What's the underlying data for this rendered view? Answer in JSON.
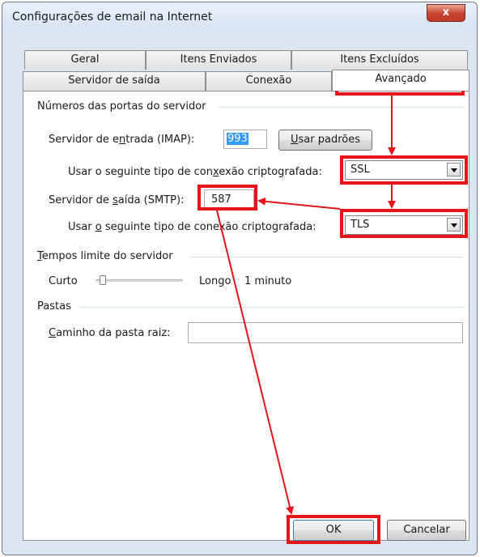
{
  "window": {
    "title": "Configurações de email na Internet",
    "close_label": "x"
  },
  "tabs": {
    "row1": [
      "Geral",
      "Itens Enviados",
      "Itens Excluídos"
    ],
    "row2": [
      "Servidor de saída",
      "Conexão",
      "Avançado"
    ],
    "active": "Avançado"
  },
  "ports": {
    "section_title": "Números das portas do servidor",
    "incoming": {
      "label_pre": "Servidor de e",
      "label_u": "n",
      "label_post": "trada (IMAP):",
      "value": "993"
    },
    "use_defaults": {
      "label_u": "U",
      "label_post": "sar padrões"
    },
    "incoming_encryption": {
      "label_pre": "Usar o seguinte tipo de con",
      "label_u": "x",
      "label_post": "exão criptografada:",
      "value": "SSL"
    },
    "outgoing": {
      "label_pre": "Servidor de ",
      "label_u": "s",
      "label_post": "aída (SMTP):",
      "value": "587"
    },
    "outgoing_encryption": {
      "label_pre": "Usar ",
      "label_u": "o",
      "label_post": " seguinte tipo de conexão criptografada:",
      "value": "TLS"
    }
  },
  "timeouts": {
    "section_title_u": "T",
    "section_title_post": "empos limite do servidor",
    "short_label": "Curto",
    "long_label": "Longo",
    "value_text": "1 minuto",
    "slider_level": 0.05
  },
  "folders": {
    "section_title": "Pastas",
    "root_path_label_u": "C",
    "root_path_label_post": "aminho da pasta raiz:",
    "root_path_value": ""
  },
  "footer": {
    "ok_label": "OK",
    "cancel_label": "Cancelar"
  },
  "annotation": {
    "highlight_color": "#e8141c"
  }
}
